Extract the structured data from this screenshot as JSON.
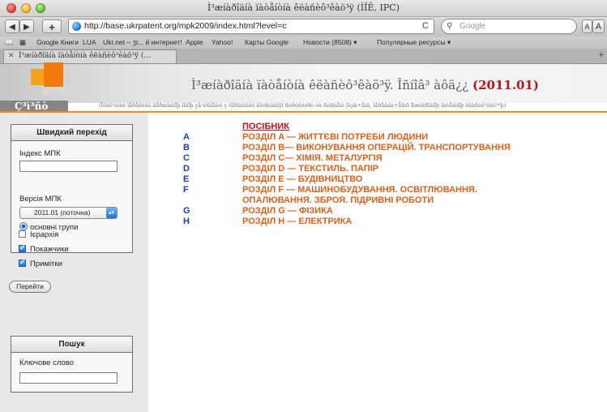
{
  "browser": {
    "window_title": "Ì³æíàðîäíà ïàòåíòíà êëàñèô³êàö³ÿ (ÌÏÊ, IPC)",
    "back_label": "◀",
    "forward_label": "▶",
    "add_label": "+",
    "url": "http://base.ukrpatent.org/mpk2009/index.html?level=c",
    "reload_label": "C",
    "search_placeholder": "Google",
    "font_small": "A",
    "font_large": "A",
    "bookmarks": [
      "Google Книги",
      "LUA",
      "Ukr.net – ӡг... й интернет!",
      "Apple",
      "Yahoo!",
      "Карты Google",
      "Новости (8508) ▾",
      "Популярные ресурсы ▾"
    ],
    "tab_title": "Ì³æíàðîäíà ïàòåíòíà êëàñèô³êàö³ÿ (..."
  },
  "header": {
    "home_label": "Ç³ì³ñò",
    "title": "Ì³æíàðîäíà ïàòåíòíà êëàñèô³êàö³ÿ. Îñíîâ³ àôä¿¿",
    "version": "(2011.01)",
    "subtitle": "(Îôàö³éíèé ïåðåêëàä äåðæàâíîþ ìîâîþ çä³éñíåíèé ç ôîðìàëüíèì äîòðèìàííÿì ñòðóêòóðè òà ñèñòåìè ïîçíà÷åíü, ïåðåäáà÷åíèõ Ìiæíàðîäíîþ ïàòåíòíîþ êëàñèô³êàö³ºþ)"
  },
  "sidebar": {
    "quick_nav": {
      "title": "Швидкий перехід",
      "ipc_index_label": "Індекс МПК",
      "ipc_index_value": "",
      "ipc_version_label": "Версія МПК",
      "ipc_version_value": "2011.01 (поточна)",
      "radio_label": "основні групи",
      "hierarchy_label": "Ієрархія",
      "indexes_label": "Покажчики",
      "notes_label": "Примітки",
      "go_label": "Перейти"
    },
    "search": {
      "title": "Пошук",
      "keyword_label": "Ключове слово",
      "keyword_value": ""
    }
  },
  "main": {
    "guide_label": "ПОСІБНИК",
    "sections": [
      {
        "letter": "A",
        "title": "РОЗДІЛ A — ЖИТТЄВІ ПОТРЕБИ ЛЮДИНИ"
      },
      {
        "letter": "B",
        "title": "РОЗДІЛ B— ВИКОНУВАННЯ ОПЕРАЦІЙ. ТРАНСПОРТУВАННЯ"
      },
      {
        "letter": "C",
        "title": "РОЗДІЛ C— ХІМІЯ. МЕТАЛУРГІЯ"
      },
      {
        "letter": "D",
        "title": "РОЗДІЛ D — ТЕКСТИЛЬ. ПАПІР"
      },
      {
        "letter": "E",
        "title": "РОЗДІЛ E — БУДІВНИЦТВО"
      },
      {
        "letter": "F",
        "title": "РОЗДІЛ F — МАШИНОБУДУВАННЯ. ОСВІТЛЮВАННЯ."
      },
      {
        "letter": "",
        "title": "ОПАЛЮВАННЯ. ЗБРОЯ. ПІДРИВНІ РОБОТИ"
      },
      {
        "letter": "G",
        "title": "РОЗДІЛ G — ФІЗИКА"
      },
      {
        "letter": "H",
        "title": "РОЗДІЛ H — ЕЛЕКТРИКА"
      }
    ]
  }
}
